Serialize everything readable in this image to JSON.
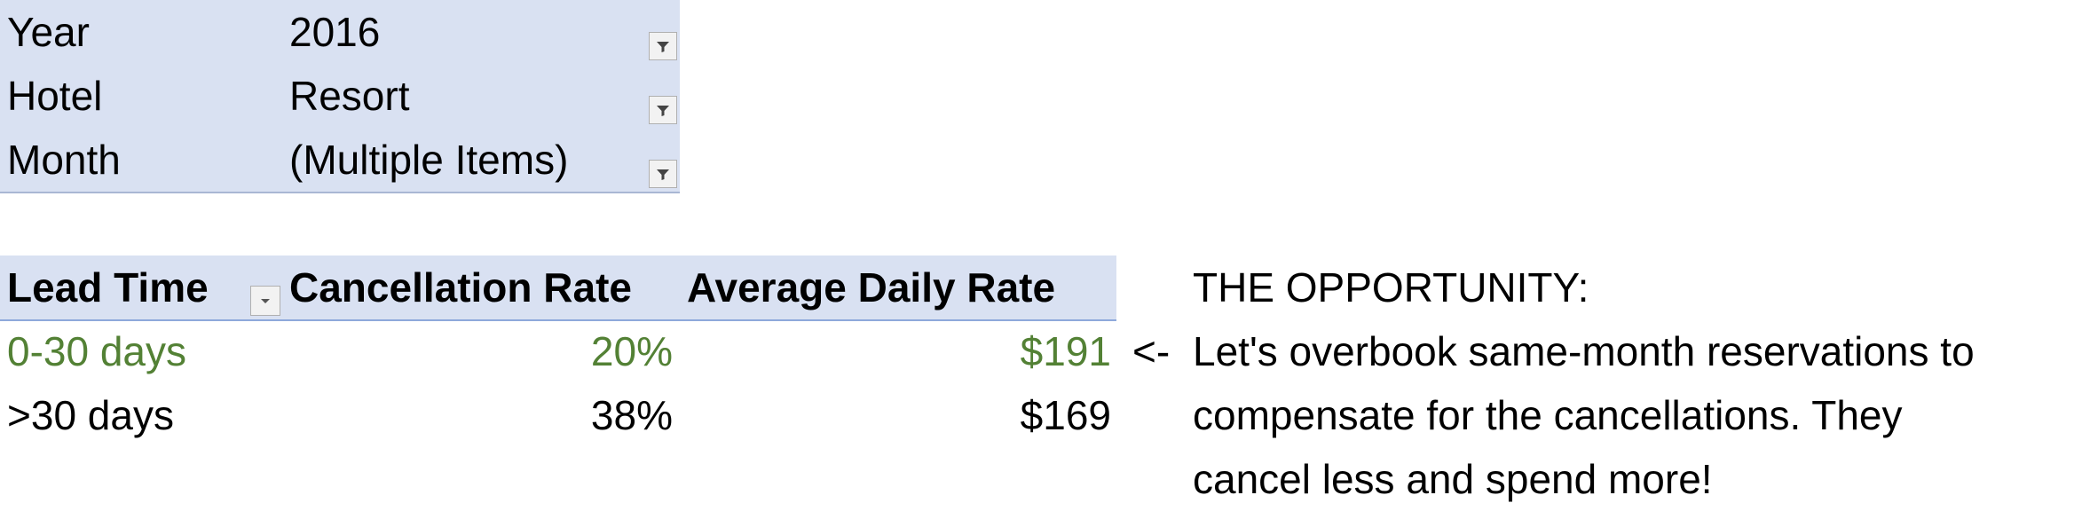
{
  "report_filters": [
    {
      "label": "Year",
      "value": "2016"
    },
    {
      "label": "Hotel",
      "value": "Resort"
    },
    {
      "label": "Month",
      "value": "(Multiple Items)"
    }
  ],
  "pivot": {
    "headers": [
      "Lead Time",
      "Cancellation Rate",
      "Average Daily Rate"
    ],
    "rows": [
      {
        "lead_time": "0-30 days",
        "cancellation_rate": "20%",
        "average_daily_rate": "$191"
      },
      {
        "lead_time": ">30 days",
        "cancellation_rate": "38%",
        "average_daily_rate": "$169"
      }
    ]
  },
  "note": {
    "arrow": "<-",
    "title": "THE OPPORTUNITY:",
    "lines": [
      "Let's overbook same-month reservations to",
      "compensate for the cancellations. They",
      "cancel less and spend more!"
    ]
  },
  "colors": {
    "header_fill": "#d9e1f2",
    "highlight_text": "#538135"
  },
  "icons": {
    "filter": "funnel-filter-icon",
    "dropdown": "chevron-down-icon"
  }
}
